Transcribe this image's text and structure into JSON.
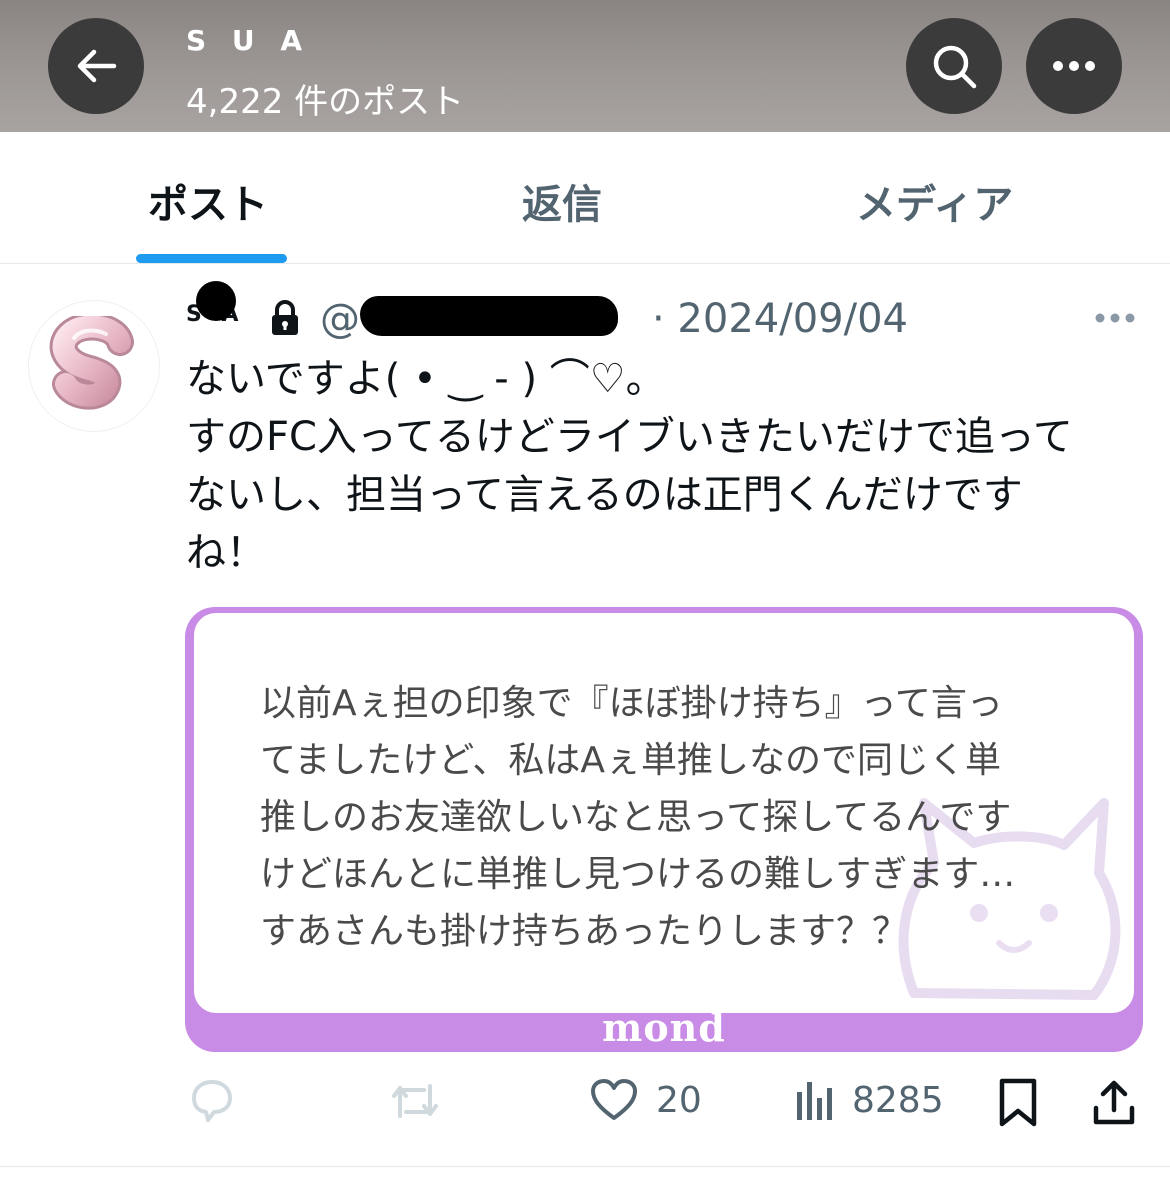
{
  "header": {
    "title": "S U A",
    "subtitle": "4,222 件のポスト"
  },
  "tabs": [
    {
      "label": "ポスト",
      "active": true
    },
    {
      "label": "返信",
      "active": false
    },
    {
      "label": "メディア",
      "active": false
    }
  ],
  "post": {
    "display_name": "S  A",
    "handle": "@",
    "date": "· 2024/09/04",
    "text": "ないですよ( • ‿ - ) ⌒♡。\nすのFC入ってるけどライブいきたいだけで追って\nないし、担当って言えるのは正門くんだけです\nね！",
    "card": {
      "question": "以前Aぇ担の印象で『ほぼ掛け持ち』って言っ\nてましたけど、私はAぇ単推しなので同じく単\n推しのお友達欲しいなと思って探してるんです\nけどほんとに単推し見つけるの難しすぎます…\nすあさんも掛け持ちあったりします？？",
      "brand": "mond"
    },
    "stats": {
      "likes": "20",
      "views": "8285"
    }
  },
  "icons": {
    "back": "arrow-left-icon",
    "search": "search-icon",
    "more": "more-horizontal-icon",
    "lock": "lock-icon",
    "reply": "reply-icon",
    "repost": "repost-icon",
    "like": "heart-icon",
    "views": "views-chart-icon",
    "bookmark": "bookmark-icon",
    "share": "share-icon"
  },
  "colors": {
    "accent": "#1d9bf0",
    "card_border": "#c88be6",
    "secondary_text": "#536471"
  }
}
